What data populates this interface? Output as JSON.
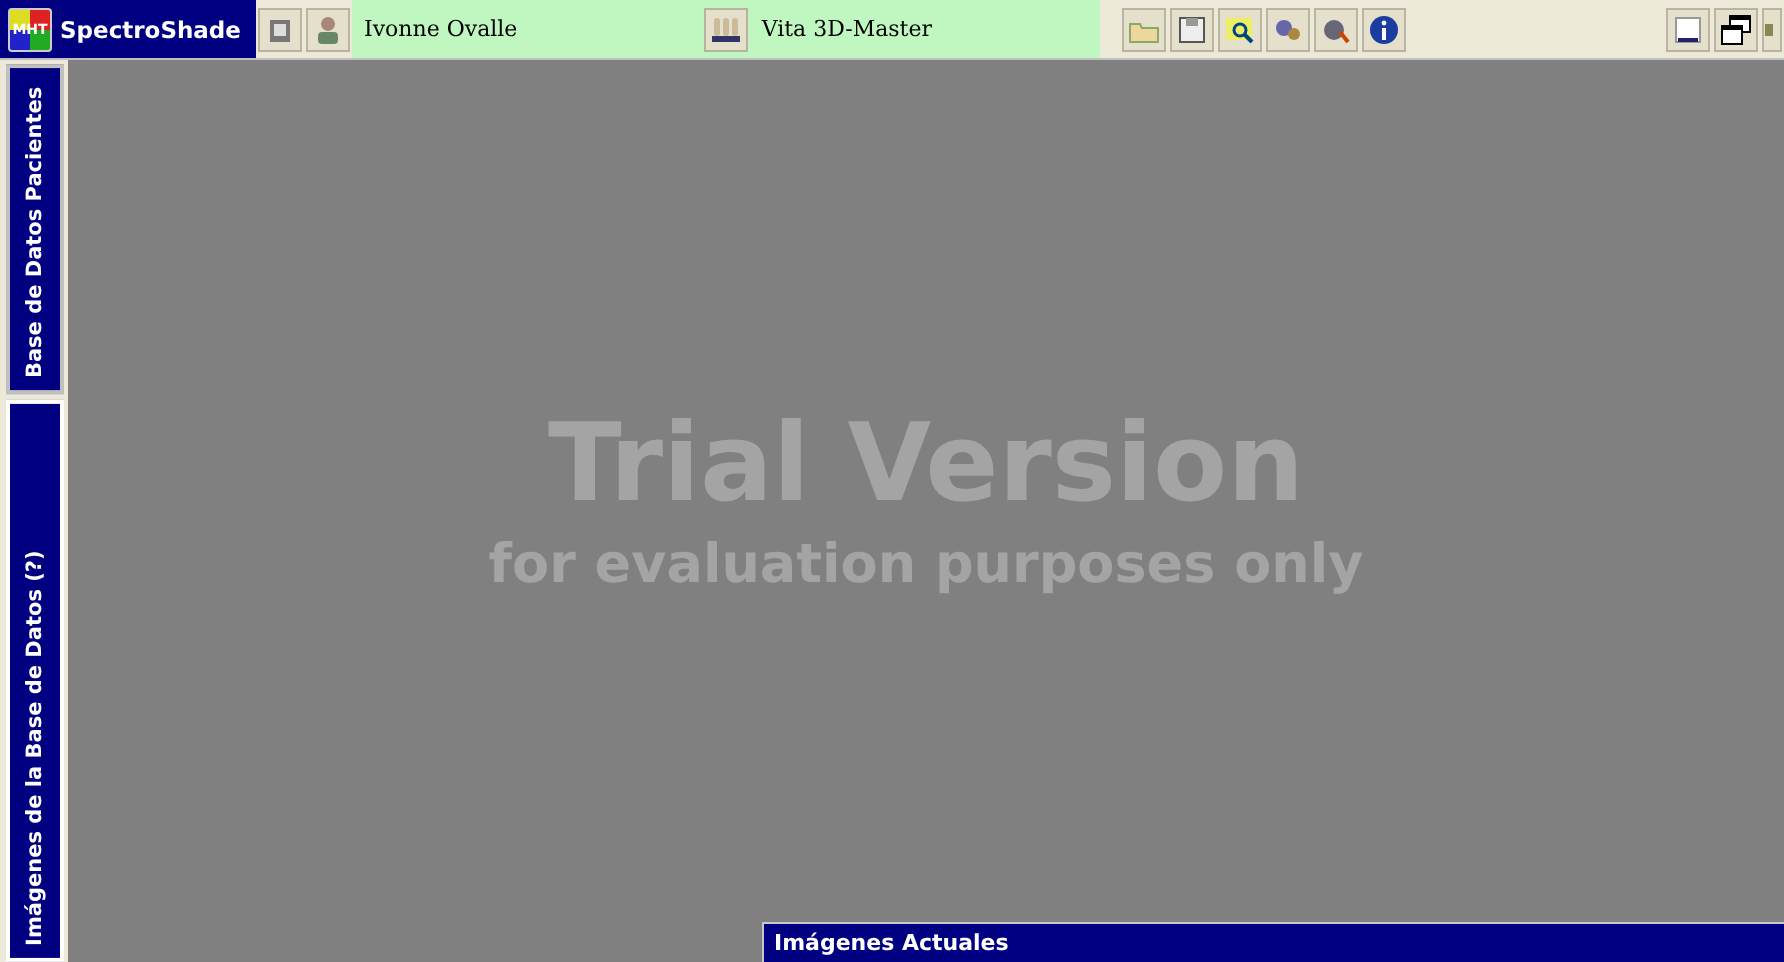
{
  "app": {
    "logo": "MHT",
    "title": "SpectroShade"
  },
  "patient": {
    "name": "Ivonne Ovalle"
  },
  "shade_guide": {
    "name": "Vita 3D-Master"
  },
  "sidebar": {
    "tabs": [
      {
        "label": "Base de Datos Pacientes",
        "selected": false
      },
      {
        "label": "Imágenes de la Base de Datos (?)",
        "selected": true
      }
    ]
  },
  "trial": {
    "title": "Trial Version",
    "subtitle": "for evaluation purposes only"
  },
  "bottom_panel": {
    "title": "Imágenes Actuales"
  }
}
